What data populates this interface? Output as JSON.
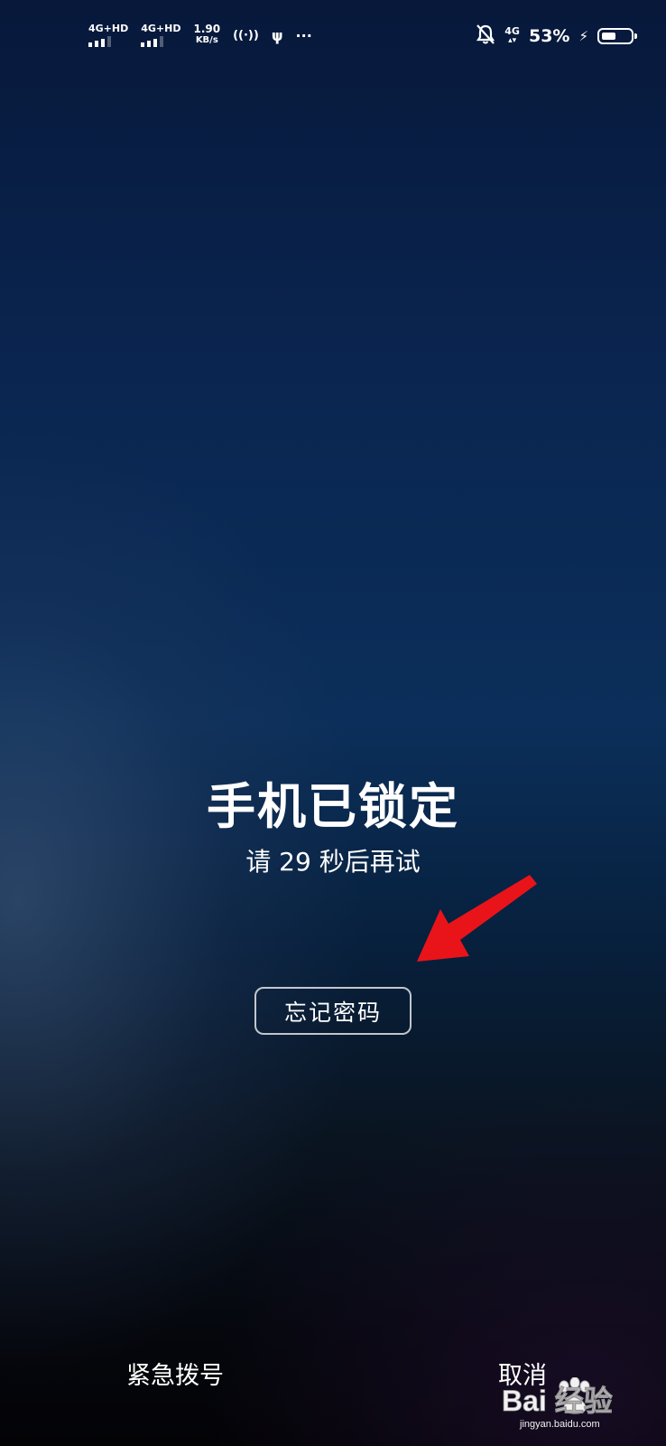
{
  "status_bar": {
    "sim1_label": "4G+HD",
    "sim2_label": "4G+HD",
    "speed_value": "1.90",
    "speed_unit": "KB/s",
    "hotspot_icon": "((·))",
    "usb_icon": "ψ",
    "more_icon": "···",
    "mute_icon": "bell-off-icon",
    "data_label": "4G",
    "battery_percent": "53%",
    "battery_level": 0.53,
    "charging_icon": "⚡"
  },
  "lock": {
    "title": "手机已锁定",
    "subtitle": "请 29 秒后再试",
    "forgot_button": "忘记密码"
  },
  "bottom": {
    "emergency_label": "紧急拨号",
    "cancel_label": "取消"
  },
  "watermark": {
    "text": "Bai 经验",
    "url": "jingyan.baidu.com"
  },
  "colors": {
    "arrow": "#e8141a"
  }
}
